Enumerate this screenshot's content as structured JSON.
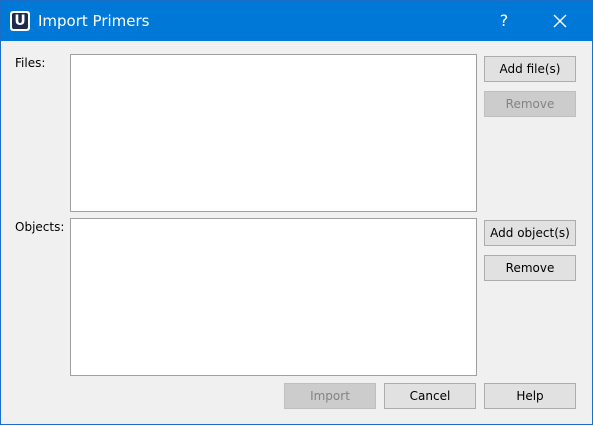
{
  "window": {
    "title": "Import Primers",
    "help_symbol": "?",
    "close_icon": "close-icon",
    "app_icon": "U"
  },
  "files": {
    "label": "Files:",
    "items": [],
    "add_button": "Add file(s)",
    "remove_button": "Remove",
    "remove_enabled": false
  },
  "objects": {
    "label": "Objects:",
    "items": [],
    "add_button": "Add object(s)",
    "remove_button": "Remove",
    "remove_enabled": true
  },
  "footer": {
    "import_button": "Import",
    "import_enabled": false,
    "cancel_button": "Cancel",
    "help_button": "Help"
  },
  "colors": {
    "titlebar": "#0078d7",
    "dialog_background": "#f0f0f0"
  }
}
